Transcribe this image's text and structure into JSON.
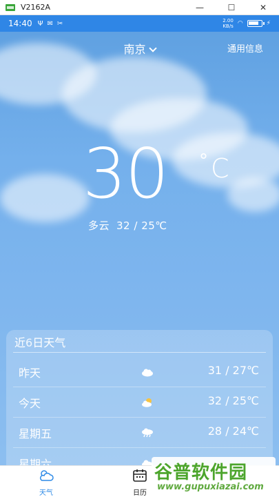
{
  "window": {
    "title": "V2162A",
    "minimize": "—",
    "maximize": "☐",
    "close": "✕"
  },
  "status_bar": {
    "time": "14:40",
    "net_speed_top": "2.00",
    "net_speed_bottom": "KB/s"
  },
  "header": {
    "city": "南京",
    "general_info": "通用信息"
  },
  "current": {
    "temperature": "30",
    "degree_symbol": "°",
    "unit": "C",
    "condition": "多云",
    "range": "32 / 25℃"
  },
  "forecast": {
    "title_prefix": "近",
    "title_count": "6",
    "title_suffix": "日天气",
    "days": [
      {
        "day": "昨天",
        "icon": "cloudy-icon",
        "range": "31 / 27℃"
      },
      {
        "day": "今天",
        "icon": "partly-cloudy-icon",
        "range": "32 / 25℃"
      },
      {
        "day": "星期五",
        "icon": "rain-icon",
        "range": "28 / 24℃"
      },
      {
        "day": "星期六",
        "icon": "cloudy-icon",
        "range": ""
      }
    ]
  },
  "tabs": [
    {
      "label": "天气",
      "icon": "weather-icon",
      "active": true
    },
    {
      "label": "日历",
      "icon": "calendar-icon",
      "active": false
    }
  ],
  "watermark": {
    "main": "谷普软件园",
    "sub": "www.gupuxiazai.com"
  },
  "colors": {
    "accent": "#2e8ae6",
    "sky_top": "#5d9fe0",
    "sky_bottom": "#8fc0f0",
    "watermark": "#4ca52c"
  }
}
